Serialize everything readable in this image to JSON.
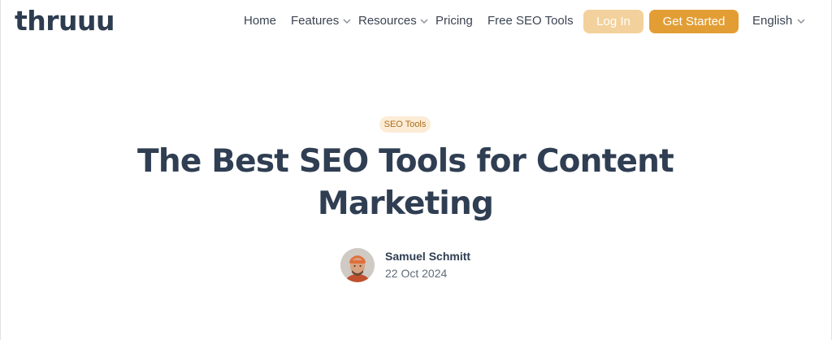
{
  "header": {
    "logo": "thruuu",
    "nav": {
      "home": "Home",
      "features": "Features",
      "resources": "Resources",
      "pricing": "Pricing",
      "free_seo_tools": "Free SEO Tools"
    },
    "login_label": "Log In",
    "get_started_label": "Get Started",
    "language": "English",
    "icons": {
      "dropdown": "chevron-down-icon"
    }
  },
  "article": {
    "category": "SEO Tools",
    "title": "The Best SEO Tools for Content Marketing",
    "author": "Samuel Schmitt",
    "date": "22 Oct 2024"
  },
  "colors": {
    "accent": "#e29e34",
    "accent_light": "#f3d19c",
    "tag_bg": "#fcecd6",
    "heading": "#2f3e52"
  }
}
